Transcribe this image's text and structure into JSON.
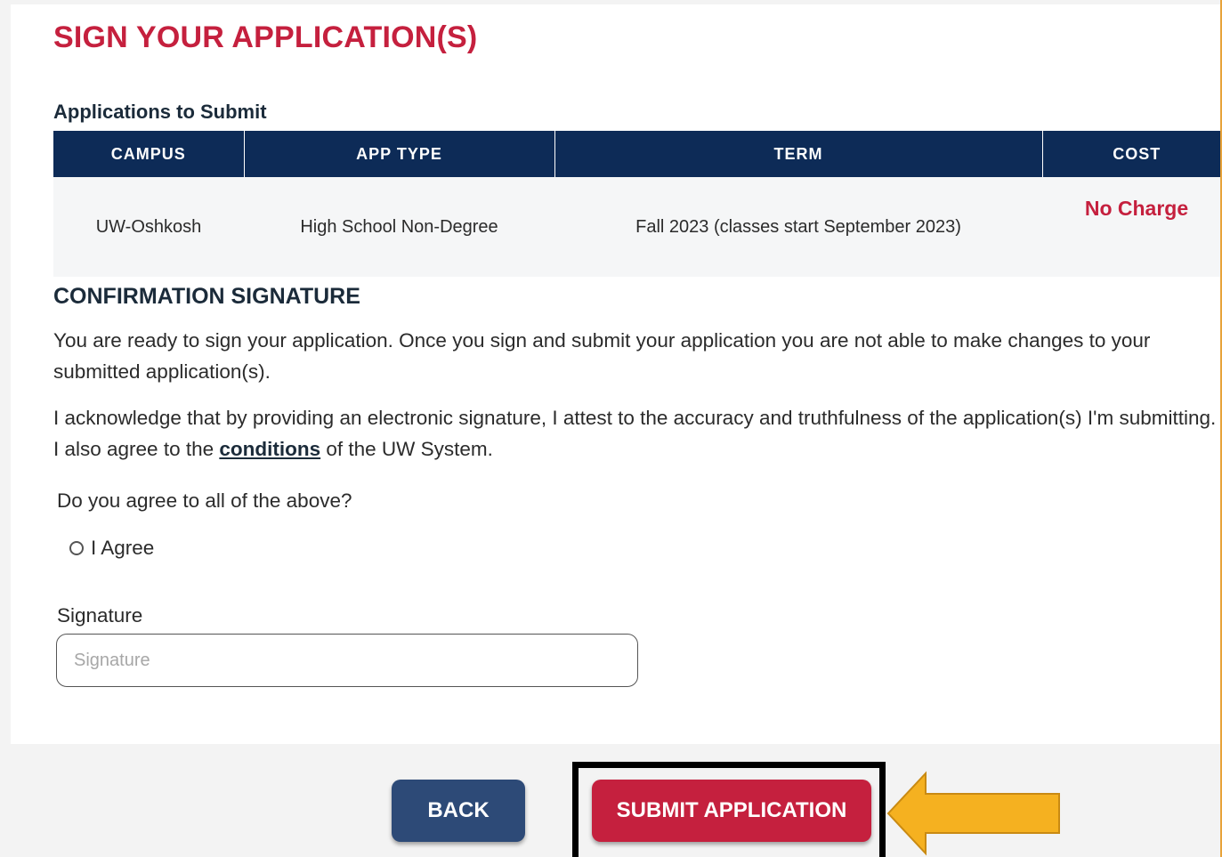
{
  "page": {
    "title": "SIGN YOUR APPLICATION(S)"
  },
  "applications": {
    "section_label": "Applications to Submit",
    "columns": [
      "CAMPUS",
      "APP TYPE",
      "TERM",
      "COST"
    ],
    "rows": [
      {
        "campus": "UW-Oshkosh",
        "app_type": "High School Non-Degree",
        "term": "Fall 2023 (classes start September 2023)",
        "cost": "No Charge"
      }
    ]
  },
  "confirmation": {
    "heading": "CONFIRMATION SIGNATURE",
    "paragraph1": "You are ready to sign your application. Once you sign and submit your application you are not able to make changes to your submitted application(s).",
    "paragraph2_before": "I acknowledge that by providing an electronic signature, I attest to the accuracy and truthfulness of the application(s) I'm submitting. I also agree to the ",
    "paragraph2_link": "conditions",
    "paragraph2_after": " of the UW System.",
    "question": "Do you agree to all of the above?",
    "agree_option": "I Agree",
    "signature_label": "Signature",
    "signature_placeholder": "Signature",
    "signature_value": ""
  },
  "actions": {
    "back_label": "BACK",
    "submit_label": "SUBMIT APPLICATION"
  },
  "colors": {
    "brand_red": "#c5203e",
    "header_navy": "#0d2b57",
    "back_button": "#2d4a77",
    "arrow_fill": "#f5b120",
    "highlight_border": "#000000"
  },
  "icons": {
    "arrow": "left-pointing-arrow-icon",
    "radio": "radio-unchecked-icon"
  }
}
